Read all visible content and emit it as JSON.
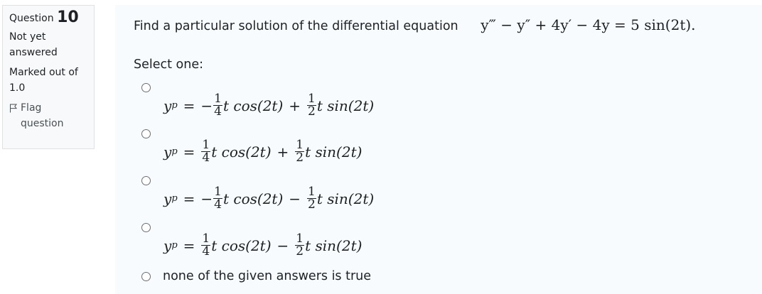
{
  "info": {
    "question_word": "Question",
    "question_number": "10",
    "state": "Not yet answered",
    "grade": "Marked out of 1.0",
    "flag_label": "Flag question"
  },
  "question": {
    "text": "Find a particular solution of the differential equation",
    "equation": "y‴ − y″ + 4y′ − 4y = 5 sin(2t).",
    "prompt": "Select one:"
  },
  "options": [
    {
      "sign1": "−",
      "f1n": "1",
      "f1d": "4",
      "t1": "t cos(2t)",
      "op": "+",
      "f2n": "1",
      "f2d": "2",
      "t2": "t sin(2t)"
    },
    {
      "sign1": "",
      "f1n": "1",
      "f1d": "4",
      "t1": "t cos(2t)",
      "op": "+",
      "f2n": "1",
      "f2d": "2",
      "t2": "t sin(2t)"
    },
    {
      "sign1": "−",
      "f1n": "1",
      "f1d": "4",
      "t1": "t cos(2t)",
      "op": "−",
      "f2n": "1",
      "f2d": "2",
      "t2": "t sin(2t)"
    },
    {
      "sign1": "",
      "f1n": "1",
      "f1d": "4",
      "t1": "t cos(2t)",
      "op": "−",
      "f2n": "1",
      "f2d": "2",
      "t2": "t sin(2t)"
    }
  ],
  "last_option": "none of the given answers is true",
  "yp_base": "y",
  "yp_sub": "p",
  "equals": "="
}
